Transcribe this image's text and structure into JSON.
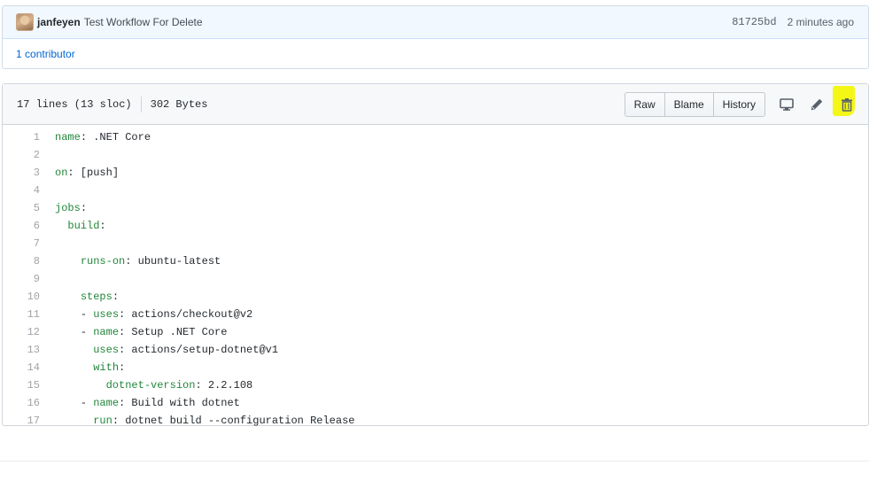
{
  "commit": {
    "author": "janfeyen",
    "message": "Test Workflow For Delete",
    "sha": "81725bd",
    "time_ago": "2 minutes ago",
    "contributors_count": "1",
    "contributors_label": "contributor"
  },
  "file": {
    "lines_info": "17 lines (13 sloc)",
    "size": "302 Bytes",
    "buttons": {
      "raw": "Raw",
      "blame": "Blame",
      "history": "History"
    },
    "icons": [
      "desktop-icon",
      "pencil-icon",
      "trash-icon"
    ],
    "highlight_color": "#f4f716"
  },
  "code": [
    {
      "n": "1",
      "indent": "",
      "key": "name",
      "rest": ": .NET Core"
    },
    {
      "n": "2",
      "indent": "",
      "key": "",
      "rest": ""
    },
    {
      "n": "3",
      "indent": "",
      "key": "on",
      "rest": ": [push]"
    },
    {
      "n": "4",
      "indent": "",
      "key": "",
      "rest": ""
    },
    {
      "n": "5",
      "indent": "",
      "key": "jobs",
      "rest": ":"
    },
    {
      "n": "6",
      "indent": "  ",
      "key": "build",
      "rest": ":"
    },
    {
      "n": "7",
      "indent": "",
      "key": "",
      "rest": ""
    },
    {
      "n": "8",
      "indent": "    ",
      "key": "runs-on",
      "rest": ": ubuntu-latest"
    },
    {
      "n": "9",
      "indent": "",
      "key": "",
      "rest": ""
    },
    {
      "n": "10",
      "indent": "    ",
      "key": "steps",
      "rest": ":"
    },
    {
      "n": "11",
      "indent": "    - ",
      "key": "uses",
      "rest": ": actions/checkout@v2"
    },
    {
      "n": "12",
      "indent": "    - ",
      "key": "name",
      "rest": ": Setup .NET Core"
    },
    {
      "n": "13",
      "indent": "      ",
      "key": "uses",
      "rest": ": actions/setup-dotnet@v1"
    },
    {
      "n": "14",
      "indent": "      ",
      "key": "with",
      "rest": ":"
    },
    {
      "n": "15",
      "indent": "        ",
      "key": "dotnet-version",
      "rest": ": 2.2.108"
    },
    {
      "n": "16",
      "indent": "    - ",
      "key": "name",
      "rest": ": Build with dotnet"
    },
    {
      "n": "17",
      "indent": "      ",
      "key": "run",
      "rest": ": dotnet build --configuration Release"
    }
  ]
}
